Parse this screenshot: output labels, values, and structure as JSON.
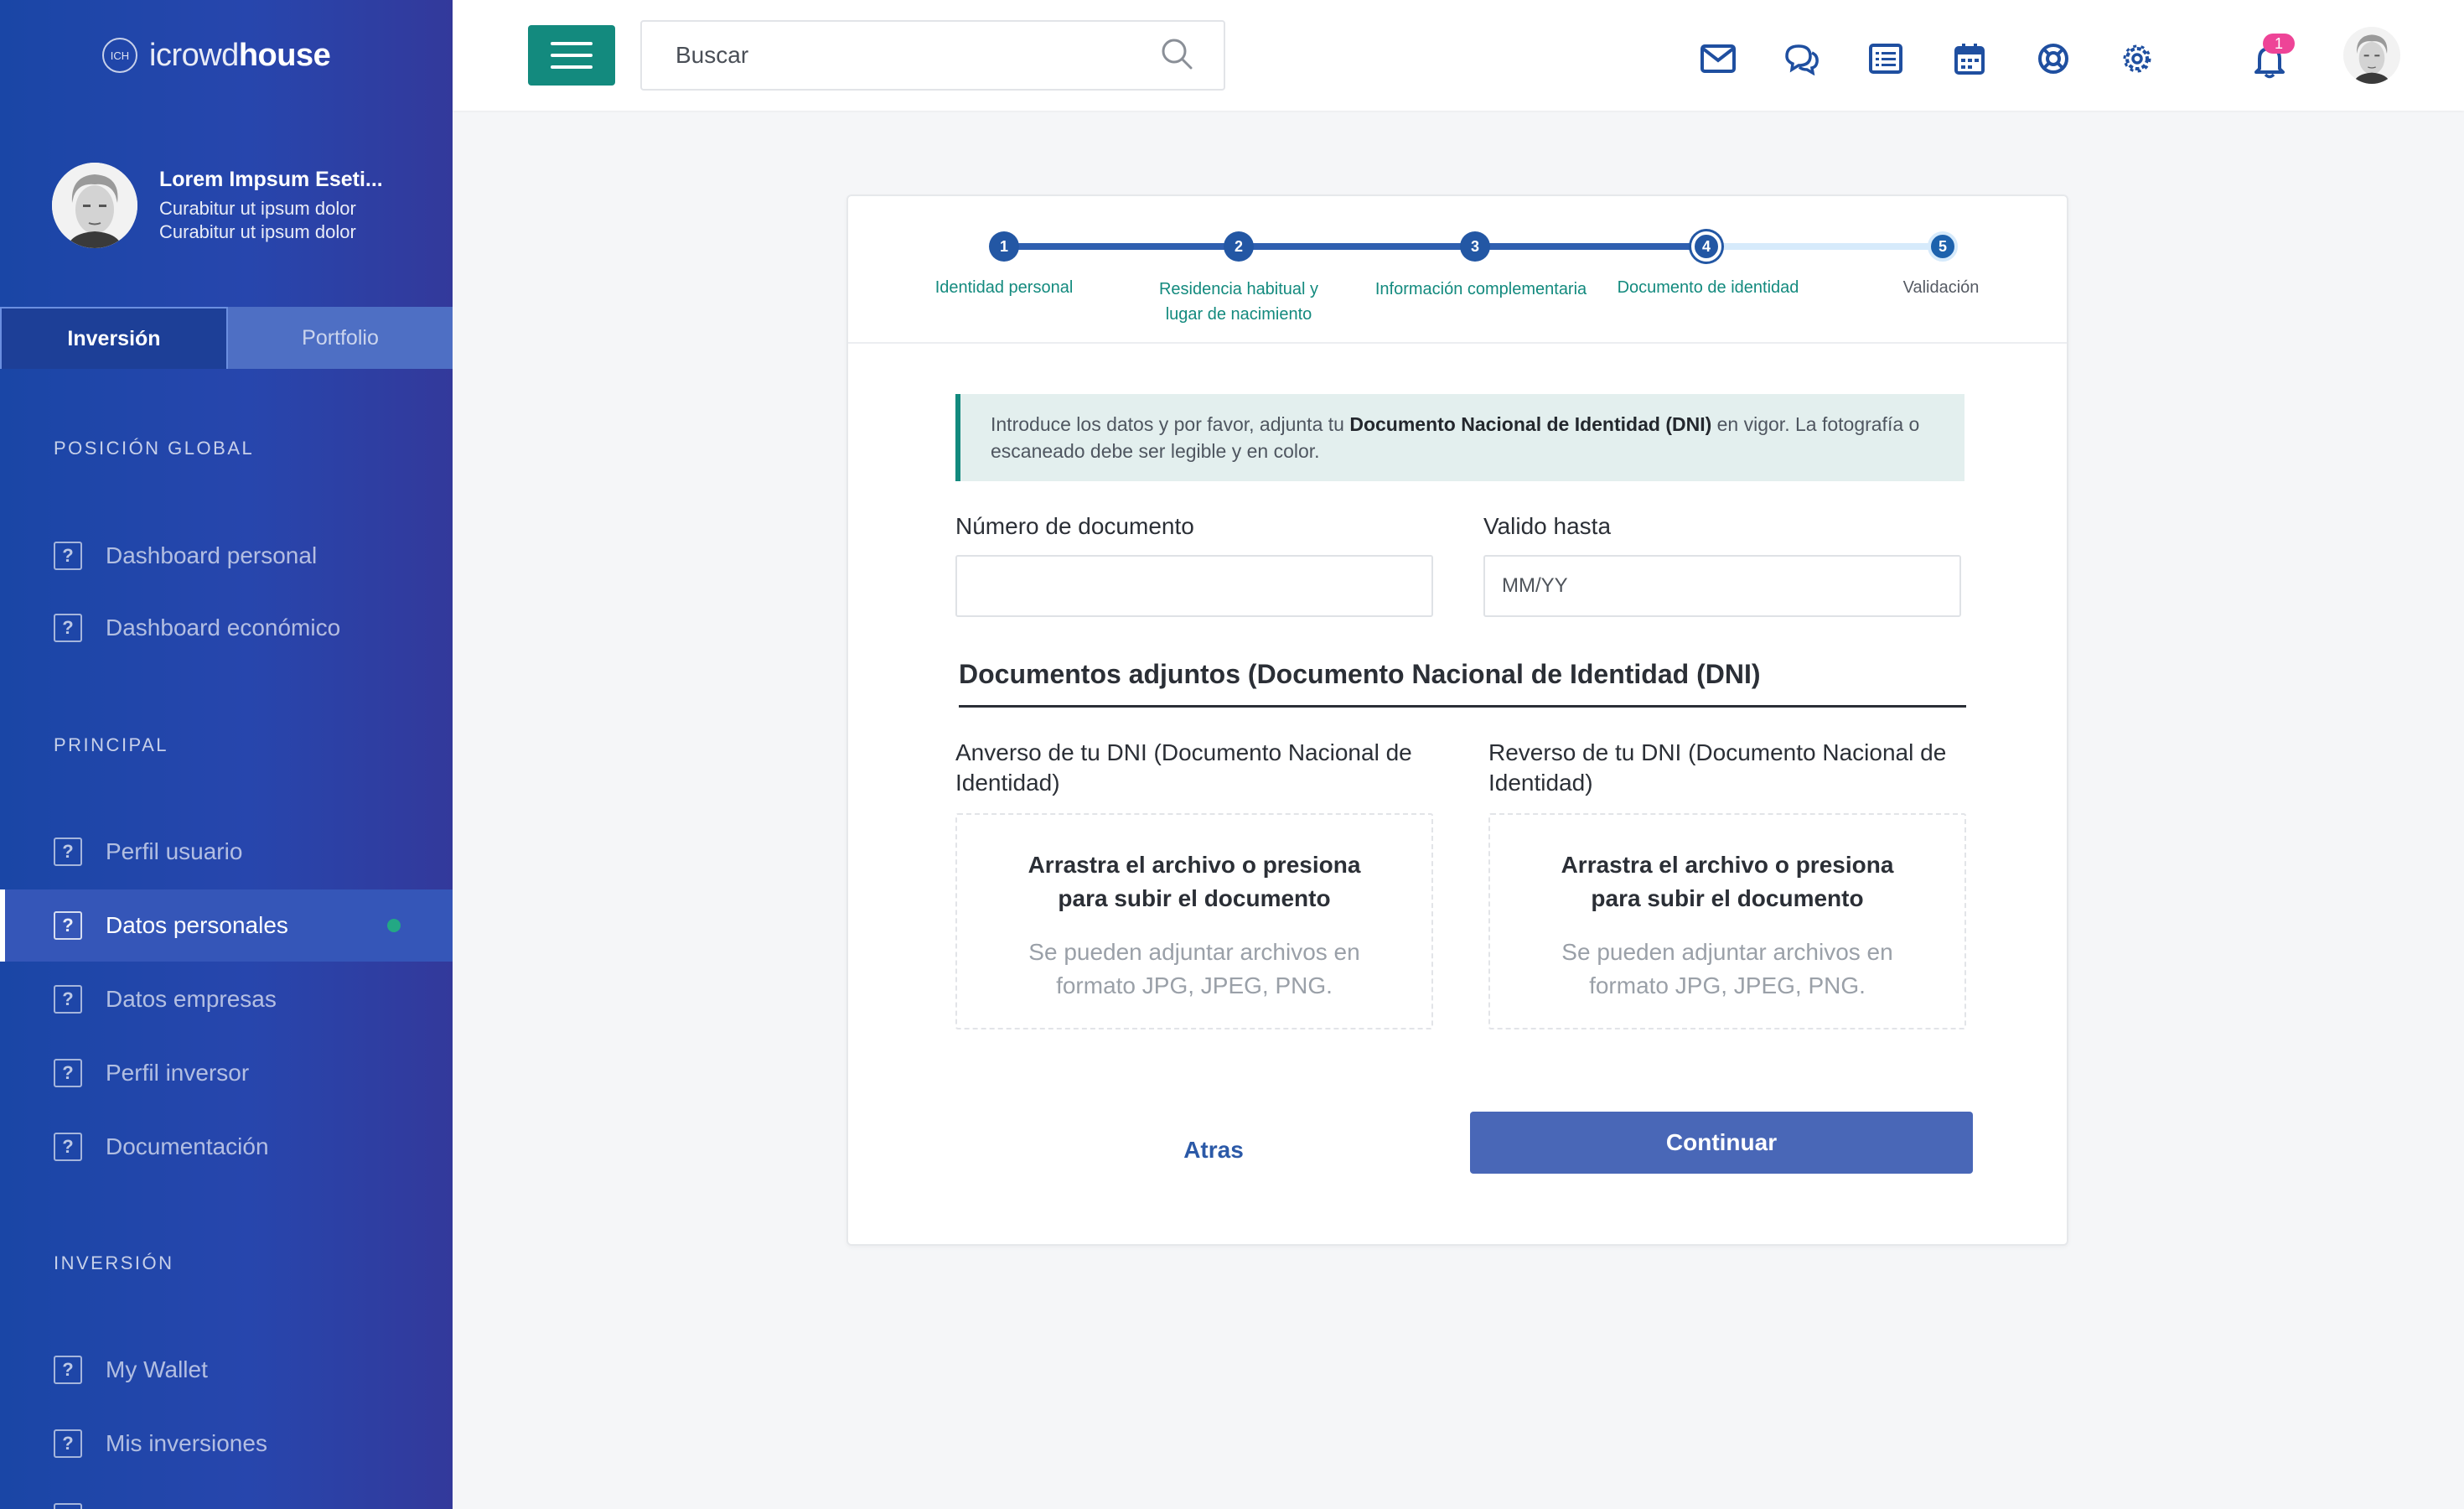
{
  "brand": {
    "mark": "ICH",
    "name_light": "icrowd",
    "name_bold": "house"
  },
  "user": {
    "name": "Lorem Impsum Eseti...",
    "line1": "Curabitur ut ipsum dolor",
    "line2": "Curabitur ut ipsum dolor"
  },
  "sidebar": {
    "tabs": [
      {
        "label": "Inversión",
        "active": true
      },
      {
        "label": "Portfolio",
        "active": false
      }
    ],
    "sections": [
      {
        "title": "POSICIÓN GLOBAL",
        "items": [
          {
            "label": "Dashboard personal"
          },
          {
            "label": "Dashboard económico"
          }
        ]
      },
      {
        "title": "PRINCIPAL",
        "items": [
          {
            "label": "Perfil usuario"
          },
          {
            "label": "Datos personales",
            "active": true
          },
          {
            "label": "Datos empresas"
          },
          {
            "label": "Perfil inversor"
          },
          {
            "label": "Documentación"
          }
        ]
      },
      {
        "title": "INVERSIÓN",
        "items": [
          {
            "label": "My Wallet"
          },
          {
            "label": "Mis inversiones"
          }
        ]
      }
    ],
    "item_icon": "?",
    "active_dot_color": "#23a884"
  },
  "topbar": {
    "search_placeholder": "Buscar",
    "icons": [
      "mail-icon",
      "chat-icon",
      "list-icon",
      "calendar-icon",
      "lifebuoy-icon",
      "gear-icon"
    ],
    "notification_count": "1",
    "accent": "#138a7e"
  },
  "stepper": {
    "current": 4,
    "steps": [
      {
        "num": "1",
        "label": "Identidad personal",
        "state": "done"
      },
      {
        "num": "2",
        "label": "Residencia habitual y",
        "label2": "lugar de nacimiento",
        "state": "done"
      },
      {
        "num": "3",
        "label": "Información complementaria",
        "state": "done"
      },
      {
        "num": "4",
        "label": "Documento de identidad",
        "state": "current"
      },
      {
        "num": "5",
        "label": "Validación",
        "state": "pending"
      }
    ]
  },
  "form": {
    "info_pre": "Introduce los datos y por favor, adjunta tu ",
    "info_bold": "Documento Nacional de Identidad (DNI)",
    "info_post": " en vigor. La fotografía o escaneado debe ser legible y en color.",
    "doc_number_label": "Número de documento",
    "doc_number_value": "",
    "valid_until_label": "Valido hasta",
    "valid_until_placeholder": "MM/YY",
    "attachments_heading": "Documentos adjuntos (Documento Nacional de Identidad (DNI)",
    "front_label": "Anverso de tu DNI (Documento Nacional de Identidad)",
    "back_label": "Reverso de tu DNI (Documento Nacional de Identidad)",
    "dropzone_title": "Arrastra el archivo o presiona para subir el documento",
    "dropzone_sub": "Se pueden adjuntar archivos en formato JPG, JPEG, PNG.",
    "back_button": "Atras",
    "continue_button": "Continuar"
  }
}
